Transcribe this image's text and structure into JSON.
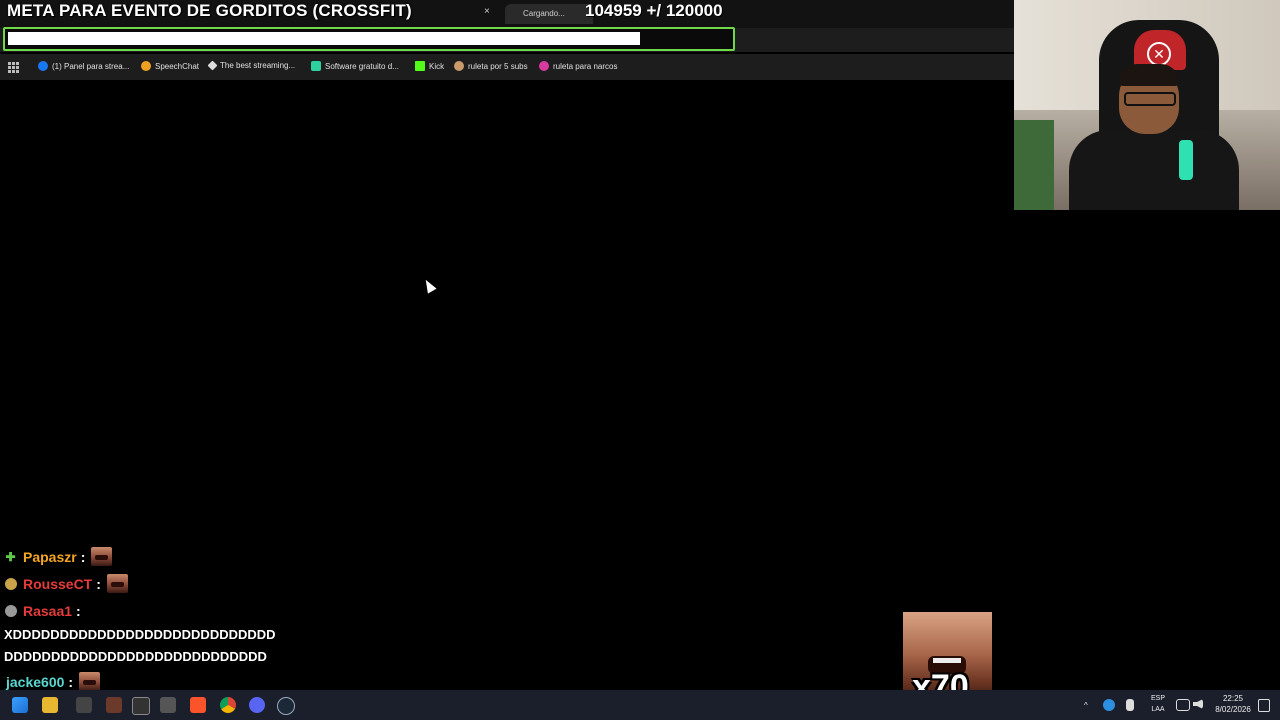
{
  "goal": {
    "title": "META PARA EVENTO DE GORDITOS (CROSSFIT)",
    "count": "104959 +/ 120000",
    "progress_fraction": 0.875
  },
  "browser": {
    "active_tab_label": "Cargando...",
    "close_glyph": "×"
  },
  "bookmarks": [
    {
      "label": "(1) Panel para strea...",
      "icon": "meta-icon",
      "color": "#1877f2"
    },
    {
      "label": "SpeechChat",
      "icon": "speechchat-icon",
      "color": "#f0a020"
    },
    {
      "label": "The best streaming...",
      "icon": "diamond-icon",
      "color": "#dddddd"
    },
    {
      "label": "Software gratuito d...",
      "icon": "software-icon",
      "color": "#2fd0a0"
    },
    {
      "label": "Kick",
      "icon": "kick-icon",
      "color": "#53fc18"
    },
    {
      "label": "ruleta por 5 subs",
      "icon": "wheel-icon",
      "color": "#c99a6a"
    },
    {
      "label": "ruleta para narcos",
      "icon": "wheel-icon",
      "color": "#d83aa0"
    }
  ],
  "chat": [
    {
      "user": "Papaszr",
      "color": "#f5a623",
      "badge": "plus-badge-icon",
      "badge_color": "#5ec94a",
      "emote": true,
      "text": ""
    },
    {
      "user": "RousseCT",
      "color": "#e53b3b",
      "badge": "coin-badge-icon",
      "badge_color": "#c9a24a",
      "emote": true,
      "text": ""
    },
    {
      "user": "Rasaa1",
      "color": "#e53b3b",
      "badge": "avatar-badge-icon",
      "badge_color": "#999999",
      "emote": false,
      "text": ""
    },
    {
      "user": "jacke600",
      "color": "#5ad6d0",
      "badge": "",
      "badge_color": "",
      "emote": true,
      "text": ""
    }
  ],
  "chat_message_lines": [
    "XDDDDDDDDDDDDDDDDDDDDDDDDDDDD",
    "DDDDDDDDDDDDDDDDDDDDDDDDDDDD"
  ],
  "combo": {
    "multiplier": "x70"
  },
  "taskbar": {
    "lang_top": "ESP",
    "lang_bottom": "LAA",
    "time": "22:25",
    "date": "8/02/2026",
    "caret": "^"
  }
}
